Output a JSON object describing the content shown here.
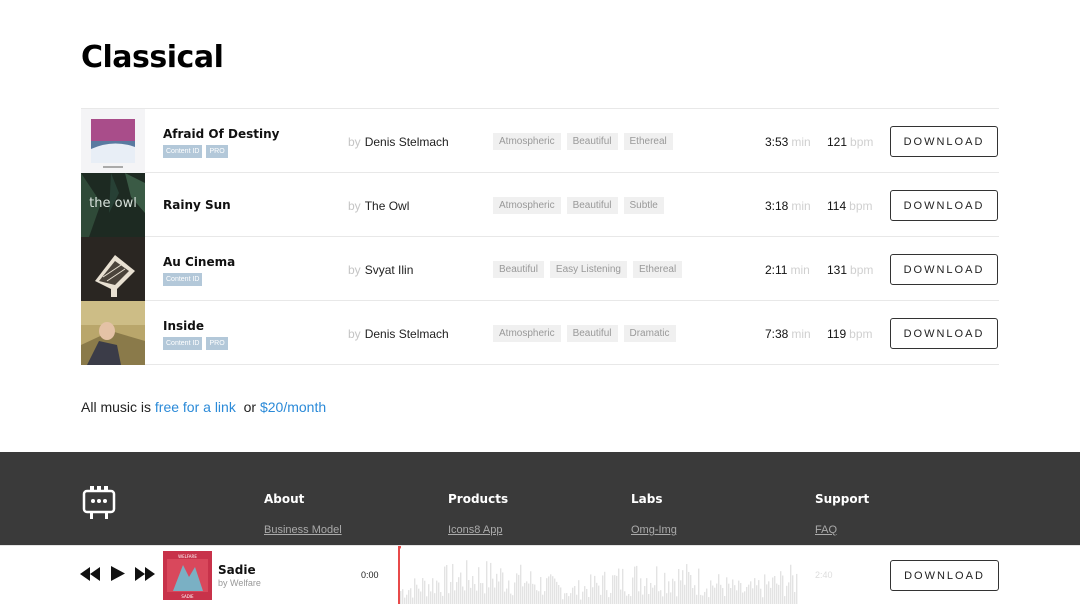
{
  "page": {
    "title": "Classical"
  },
  "tracks": [
    {
      "title": "Afraid Of Destiny",
      "badges": [
        "Content ID",
        "PRO"
      ],
      "by": "by",
      "artist": "Denis Stelmach",
      "tags": [
        "Atmospheric",
        "Beautiful",
        "Ethereal"
      ],
      "duration": "3:53",
      "duration_unit": "min",
      "bpm": "121",
      "bpm_unit": "bpm",
      "download_label": "DOWNLOAD"
    },
    {
      "title": "Rainy Sun",
      "badges": [],
      "by": "by",
      "artist": "The Owl",
      "cover_text": "the owl",
      "tags": [
        "Atmospheric",
        "Beautiful",
        "Subtle"
      ],
      "duration": "3:18",
      "duration_unit": "min",
      "bpm": "114",
      "bpm_unit": "bpm",
      "download_label": "DOWNLOAD"
    },
    {
      "title": "Au Cinema",
      "badges": [
        "Content ID"
      ],
      "by": "by",
      "artist": "Svyat Ilin",
      "tags": [
        "Beautiful",
        "Easy Listening",
        "Ethereal"
      ],
      "duration": "2:11",
      "duration_unit": "min",
      "bpm": "131",
      "bpm_unit": "bpm",
      "download_label": "DOWNLOAD"
    },
    {
      "title": "Inside",
      "badges": [
        "Content ID",
        "PRO"
      ],
      "by": "by",
      "artist": "Denis Stelmach",
      "tags": [
        "Atmospheric",
        "Beautiful",
        "Dramatic"
      ],
      "duration": "7:38",
      "duration_unit": "min",
      "bpm": "119",
      "bpm_unit": "bpm",
      "download_label": "DOWNLOAD"
    }
  ],
  "license": {
    "prefix": "All music is",
    "free_link": "free for a link",
    "or": "or",
    "paid_link": "$20/month"
  },
  "footer": {
    "logo_icon": "icons8-logo-icon",
    "columns": [
      {
        "heading": "About",
        "link": "Business Model"
      },
      {
        "heading": "Products",
        "link": "Icons8 App"
      },
      {
        "heading": "Labs",
        "link": "Omg-Img"
      },
      {
        "heading": "Support",
        "link": "FAQ"
      }
    ]
  },
  "player": {
    "title": "Sadie",
    "artist": "by Welfare",
    "cover_top": "WELFARE",
    "cover_bottom": "SADIE",
    "current_time": "0:00",
    "end_time": "2:40",
    "download_label": "DOWNLOAD",
    "progress": 0
  }
}
